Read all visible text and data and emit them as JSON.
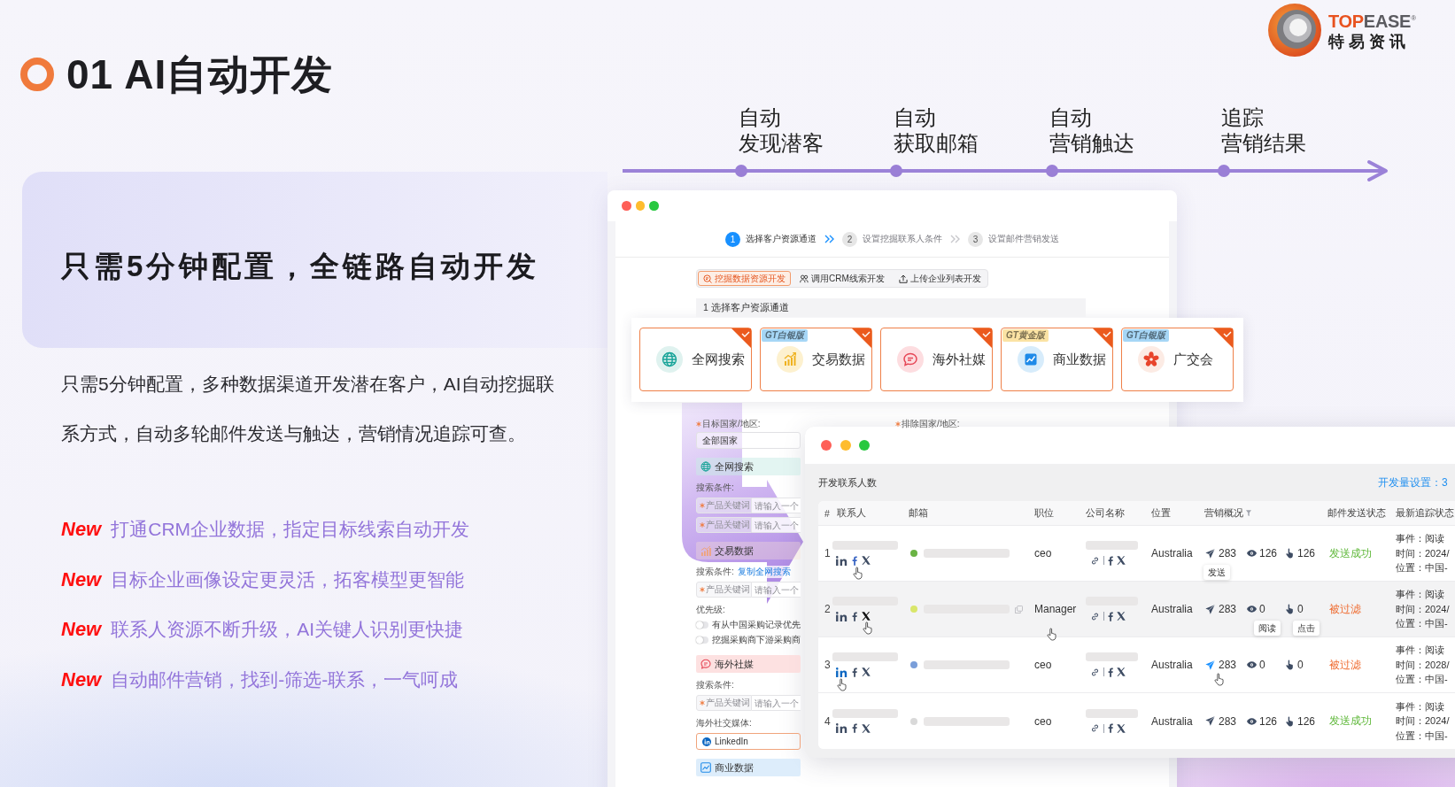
{
  "title": "01 AI自动开发",
  "logo": {
    "wordmark": [
      "TOP",
      "EASE"
    ],
    "registered": "®",
    "name": "特易资讯"
  },
  "timeline": [
    {
      "lines": [
        "自动",
        "发现潜客"
      ]
    },
    {
      "lines": [
        "自动",
        "获取邮箱"
      ]
    },
    {
      "lines": [
        "自动",
        "营销触达"
      ]
    },
    {
      "lines": [
        "追踪",
        "营销结果"
      ]
    }
  ],
  "intro_card": {
    "heading": "只需5分钟配置，全链路自动开发"
  },
  "description": "只需5分钟配置，多种数据渠道开发潜在客户，AI自动挖掘联系方式，自动多轮邮件发送与触达，营销情况追踪可查。",
  "features": [
    {
      "badge": "New",
      "text": "打通CRM企业数据，指定目标线索自动开发"
    },
    {
      "badge": "New",
      "text": "目标企业画像设定更灵活，拓客模型更智能"
    },
    {
      "badge": "New",
      "text": "联系人资源不断升级，AI关键人识别更快捷"
    },
    {
      "badge": "New",
      "text": "自动邮件营销，找到-筛选-联系，一气呵成"
    }
  ],
  "setup_window": {
    "steps": [
      {
        "number": "1",
        "label": "选择客户资源通道",
        "selected": true
      },
      {
        "number": "2",
        "label": "设置挖掘联系人条件",
        "selected": false
      },
      {
        "number": "3",
        "label": "设置邮件营销发送",
        "selected": false
      }
    ],
    "source_tabs": [
      {
        "label": "挖掘数据资源开发",
        "selected": true
      },
      {
        "label": "调用CRM线索开发",
        "selected": false
      },
      {
        "label": "上传企业列表开发",
        "selected": false
      }
    ],
    "section_title": "1 选择客户资源通道",
    "channels": [
      {
        "label": "全网搜索",
        "selected": true
      },
      {
        "label": "交易数据",
        "badge": {
          "text": "GT白银版",
          "color": "#a6d6f6"
        },
        "selected": true
      },
      {
        "label": "海外社媒",
        "selected": true
      },
      {
        "label": "商业数据",
        "badge": {
          "text": "GT黄金版",
          "color": "#fbe3a4"
        },
        "selected": true
      },
      {
        "label": "广交会",
        "badge": {
          "text": "GT白银版",
          "color": "#a6d6f6"
        },
        "selected": true
      }
    ],
    "form": [
      {
        "kind": "label",
        "text": "目标国家/地区:",
        "required": true
      },
      {
        "kind": "select",
        "value": "全部国家"
      },
      {
        "kind": "section",
        "text": "全网搜索"
      },
      {
        "kind": "label",
        "text": "搜索条件:",
        "required": false
      },
      {
        "kind": "keyword",
        "label": "产品关键词",
        "placeholder": "请输入一个",
        "required": true
      },
      {
        "kind": "keyword",
        "label": "产品关键词",
        "placeholder": "请输入一个",
        "required": true
      },
      {
        "kind": "section",
        "text": "交易数据"
      },
      {
        "kind": "label",
        "text": "搜索条件:",
        "required": false,
        "link": "复制全网搜索"
      },
      {
        "kind": "keyword",
        "label": "产品关键词",
        "placeholder": "请输入一个",
        "required": true
      },
      {
        "kind": "label",
        "text": "优先级:",
        "required": false
      },
      {
        "kind": "toggle",
        "text": "有从中国采购记录优先",
        "on": false
      },
      {
        "kind": "toggle",
        "text": "挖掘采购商下游采购商",
        "on": false
      },
      {
        "kind": "section",
        "text": "海外社媒"
      },
      {
        "kind": "label",
        "text": "搜索条件:",
        "required": false
      },
      {
        "kind": "keyword",
        "label": "产品关键词",
        "placeholder": "请输入一个",
        "required": true
      },
      {
        "kind": "label",
        "text": "海外社交媒体:",
        "required": false
      },
      {
        "kind": "tag_select",
        "value": "LinkedIn"
      },
      {
        "kind": "section",
        "text": "商业数据"
      }
    ],
    "exclude_label": {
      "text": "排除国家/地区:",
      "required": true
    }
  },
  "contacts_window": {
    "title": "开发联系人数",
    "quota": "开发量设置：3",
    "columns": [
      {
        "label": "#",
        "filter": false
      },
      {
        "label": "联系人",
        "filter": false
      },
      {
        "label": "邮箱",
        "filter": false
      },
      {
        "label": "职位",
        "filter": false
      },
      {
        "label": "公司名称",
        "filter": false
      },
      {
        "label": "位置",
        "filter": false
      },
      {
        "label": "营销概况",
        "filter": true
      },
      {
        "label": "邮件发送状态",
        "filter": false
      },
      {
        "label": "最新追踪状态",
        "filter": false
      }
    ],
    "rows": [
      {
        "number": "1",
        "highlighted": false,
        "socials": [
          {
            "kind": "linkedin",
            "hovered": false
          },
          {
            "kind": "facebook",
            "hovered": true
          },
          {
            "kind": "x",
            "hovered": false
          }
        ],
        "status_dot": {
          "color": "#6ab344"
        },
        "title": "ceo",
        "location": "Australia",
        "metrics": [
          {
            "kind": "sent",
            "value": "283",
            "hovered": false,
            "tooltip": "发送"
          },
          {
            "kind": "read",
            "value": "126",
            "hovered": false
          },
          {
            "kind": "click",
            "value": "126",
            "hovered": false
          }
        ],
        "status": {
          "kind": "success",
          "text": "发送成功"
        },
        "tracking": [
          "事件：阅读",
          "时间：2024/",
          "位置：中国-"
        ]
      },
      {
        "number": "2",
        "highlighted": true,
        "socials": [
          {
            "kind": "linkedin",
            "hovered": false
          },
          {
            "kind": "facebook",
            "hovered": false
          },
          {
            "kind": "x",
            "hovered": true
          }
        ],
        "status_dot": {
          "color": "#d9e66a"
        },
        "title": "Manager",
        "location": "Australia",
        "metrics": [
          {
            "kind": "sent",
            "value": "283",
            "hovered": false
          },
          {
            "kind": "read",
            "value": "0",
            "hovered": false,
            "tooltip": "阅读"
          },
          {
            "kind": "click",
            "value": "0",
            "hovered": false,
            "tooltip": "点击"
          }
        ],
        "status": {
          "kind": "filtered",
          "text": "被过滤"
        },
        "tracking": [
          "事件：阅读",
          "时间：2024/",
          "位置：中国-"
        ]
      },
      {
        "number": "3",
        "highlighted": false,
        "socials": [
          {
            "kind": "linkedin",
            "hovered": true
          },
          {
            "kind": "facebook",
            "hovered": false
          },
          {
            "kind": "x",
            "hovered": false
          }
        ],
        "status_dot": {
          "color": "#7a9ed9"
        },
        "title": "ceo",
        "location": "Australia",
        "metrics": [
          {
            "kind": "sent",
            "value": "283",
            "hovered": true
          },
          {
            "kind": "read",
            "value": "0",
            "hovered": false
          },
          {
            "kind": "click",
            "value": "0",
            "hovered": false
          }
        ],
        "status": {
          "kind": "filtered",
          "text": "被过滤"
        },
        "tracking": [
          "事件：阅读",
          "时间：2028/",
          "位置：中国-"
        ]
      },
      {
        "number": "4",
        "highlighted": false,
        "socials": [
          {
            "kind": "linkedin",
            "hovered": false
          },
          {
            "kind": "facebook",
            "hovered": false
          },
          {
            "kind": "x",
            "hovered": false
          }
        ],
        "status_dot": {
          "color": "#d9d9d9"
        },
        "title": "ceo",
        "location": "Australia",
        "metrics": [
          {
            "kind": "sent",
            "value": "283",
            "hovered": false
          },
          {
            "kind": "read",
            "value": "126",
            "hovered": false
          },
          {
            "kind": "click",
            "value": "126",
            "hovered": false
          }
        ],
        "status": {
          "kind": "success",
          "text": "发送成功"
        },
        "tracking": [
          "事件：阅读",
          "时间：2024/",
          "位置：中国-"
        ]
      }
    ]
  }
}
